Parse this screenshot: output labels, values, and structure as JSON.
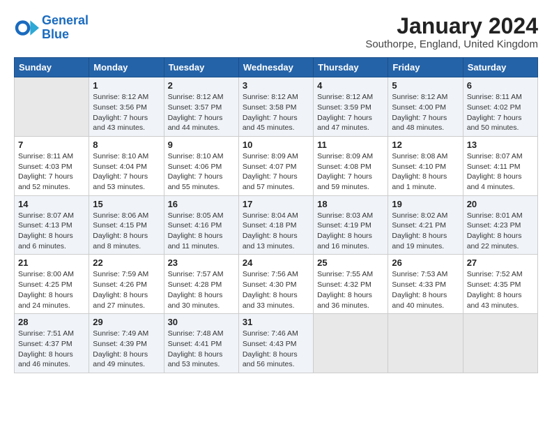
{
  "logo": {
    "text_general": "General",
    "text_blue": "Blue"
  },
  "header": {
    "month_title": "January 2024",
    "subtitle": "Southorpe, England, United Kingdom"
  },
  "weekdays": [
    "Sunday",
    "Monday",
    "Tuesday",
    "Wednesday",
    "Thursday",
    "Friday",
    "Saturday"
  ],
  "weeks": [
    [
      {
        "num": "",
        "info": ""
      },
      {
        "num": "1",
        "info": "Sunrise: 8:12 AM\nSunset: 3:56 PM\nDaylight: 7 hours\nand 43 minutes."
      },
      {
        "num": "2",
        "info": "Sunrise: 8:12 AM\nSunset: 3:57 PM\nDaylight: 7 hours\nand 44 minutes."
      },
      {
        "num": "3",
        "info": "Sunrise: 8:12 AM\nSunset: 3:58 PM\nDaylight: 7 hours\nand 45 minutes."
      },
      {
        "num": "4",
        "info": "Sunrise: 8:12 AM\nSunset: 3:59 PM\nDaylight: 7 hours\nand 47 minutes."
      },
      {
        "num": "5",
        "info": "Sunrise: 8:12 AM\nSunset: 4:00 PM\nDaylight: 7 hours\nand 48 minutes."
      },
      {
        "num": "6",
        "info": "Sunrise: 8:11 AM\nSunset: 4:02 PM\nDaylight: 7 hours\nand 50 minutes."
      }
    ],
    [
      {
        "num": "7",
        "info": "Sunrise: 8:11 AM\nSunset: 4:03 PM\nDaylight: 7 hours\nand 52 minutes."
      },
      {
        "num": "8",
        "info": "Sunrise: 8:10 AM\nSunset: 4:04 PM\nDaylight: 7 hours\nand 53 minutes."
      },
      {
        "num": "9",
        "info": "Sunrise: 8:10 AM\nSunset: 4:06 PM\nDaylight: 7 hours\nand 55 minutes."
      },
      {
        "num": "10",
        "info": "Sunrise: 8:09 AM\nSunset: 4:07 PM\nDaylight: 7 hours\nand 57 minutes."
      },
      {
        "num": "11",
        "info": "Sunrise: 8:09 AM\nSunset: 4:08 PM\nDaylight: 7 hours\nand 59 minutes."
      },
      {
        "num": "12",
        "info": "Sunrise: 8:08 AM\nSunset: 4:10 PM\nDaylight: 8 hours\nand 1 minute."
      },
      {
        "num": "13",
        "info": "Sunrise: 8:07 AM\nSunset: 4:11 PM\nDaylight: 8 hours\nand 4 minutes."
      }
    ],
    [
      {
        "num": "14",
        "info": "Sunrise: 8:07 AM\nSunset: 4:13 PM\nDaylight: 8 hours\nand 6 minutes."
      },
      {
        "num": "15",
        "info": "Sunrise: 8:06 AM\nSunset: 4:15 PM\nDaylight: 8 hours\nand 8 minutes."
      },
      {
        "num": "16",
        "info": "Sunrise: 8:05 AM\nSunset: 4:16 PM\nDaylight: 8 hours\nand 11 minutes."
      },
      {
        "num": "17",
        "info": "Sunrise: 8:04 AM\nSunset: 4:18 PM\nDaylight: 8 hours\nand 13 minutes."
      },
      {
        "num": "18",
        "info": "Sunrise: 8:03 AM\nSunset: 4:19 PM\nDaylight: 8 hours\nand 16 minutes."
      },
      {
        "num": "19",
        "info": "Sunrise: 8:02 AM\nSunset: 4:21 PM\nDaylight: 8 hours\nand 19 minutes."
      },
      {
        "num": "20",
        "info": "Sunrise: 8:01 AM\nSunset: 4:23 PM\nDaylight: 8 hours\nand 22 minutes."
      }
    ],
    [
      {
        "num": "21",
        "info": "Sunrise: 8:00 AM\nSunset: 4:25 PM\nDaylight: 8 hours\nand 24 minutes."
      },
      {
        "num": "22",
        "info": "Sunrise: 7:59 AM\nSunset: 4:26 PM\nDaylight: 8 hours\nand 27 minutes."
      },
      {
        "num": "23",
        "info": "Sunrise: 7:57 AM\nSunset: 4:28 PM\nDaylight: 8 hours\nand 30 minutes."
      },
      {
        "num": "24",
        "info": "Sunrise: 7:56 AM\nSunset: 4:30 PM\nDaylight: 8 hours\nand 33 minutes."
      },
      {
        "num": "25",
        "info": "Sunrise: 7:55 AM\nSunset: 4:32 PM\nDaylight: 8 hours\nand 36 minutes."
      },
      {
        "num": "26",
        "info": "Sunrise: 7:53 AM\nSunset: 4:33 PM\nDaylight: 8 hours\nand 40 minutes."
      },
      {
        "num": "27",
        "info": "Sunrise: 7:52 AM\nSunset: 4:35 PM\nDaylight: 8 hours\nand 43 minutes."
      }
    ],
    [
      {
        "num": "28",
        "info": "Sunrise: 7:51 AM\nSunset: 4:37 PM\nDaylight: 8 hours\nand 46 minutes."
      },
      {
        "num": "29",
        "info": "Sunrise: 7:49 AM\nSunset: 4:39 PM\nDaylight: 8 hours\nand 49 minutes."
      },
      {
        "num": "30",
        "info": "Sunrise: 7:48 AM\nSunset: 4:41 PM\nDaylight: 8 hours\nand 53 minutes."
      },
      {
        "num": "31",
        "info": "Sunrise: 7:46 AM\nSunset: 4:43 PM\nDaylight: 8 hours\nand 56 minutes."
      },
      {
        "num": "",
        "info": ""
      },
      {
        "num": "",
        "info": ""
      },
      {
        "num": "",
        "info": ""
      }
    ]
  ]
}
